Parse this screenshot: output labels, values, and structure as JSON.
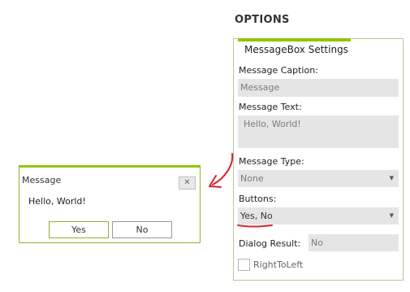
{
  "message_box": {
    "title": "Message",
    "close_glyph": "✕",
    "text": "Hello, World!",
    "buttons": [
      "Yes",
      "No"
    ]
  },
  "options": {
    "heading": "OPTIONS",
    "panel_title": "MessageBox Settings",
    "caption_label": "Message Caption:",
    "caption_value": "Message",
    "text_label": "Message Text:",
    "text_value": "Hello, World!",
    "type_label": "Message Type:",
    "type_value": "None",
    "buttons_label": "Buttons:",
    "buttons_value": "Yes, No",
    "result_label": "Dialog Result:",
    "result_value": "No",
    "rtl_label": "RightToLeft",
    "rtl_checked": false
  },
  "icons": {
    "dropdown": "chevron-down-icon",
    "close": "close-icon"
  },
  "colors": {
    "accent": "#8fc600",
    "annotation": "#d8232a"
  }
}
